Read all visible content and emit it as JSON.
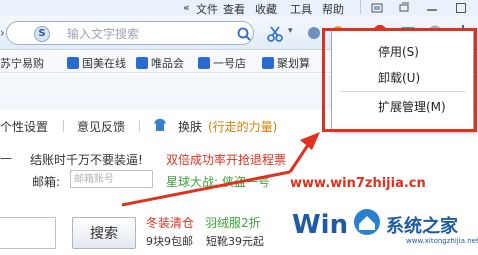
{
  "menubar": {
    "items": [
      {
        "label": "文件"
      },
      {
        "label": "查看"
      },
      {
        "label": "收藏"
      },
      {
        "label": "工具"
      },
      {
        "label": "帮助"
      }
    ]
  },
  "toolbar": {
    "search_placeholder": "输入文字搜索"
  },
  "bookmarks": {
    "items": [
      {
        "label": "苏宁易购",
        "icon": "suning-icon",
        "color": "#f2b233"
      },
      {
        "label": "国美在线",
        "icon": "gome-icon",
        "color": "#2a6bd1"
      },
      {
        "label": "唯品会",
        "icon": "vip-icon",
        "color": "#2a6bd1"
      },
      {
        "label": "一号店",
        "icon": "yhd-icon",
        "color": "#2a6bd1"
      },
      {
        "label": "聚划算",
        "icon": "juhuasuan-icon",
        "color": "#2a6bd1"
      }
    ]
  },
  "nav": {
    "personal_settings": "个性设置",
    "feedback": "意见反馈",
    "skin": "换肤",
    "skin_name": "(行走的力量)"
  },
  "promo": {
    "line1_left": "—",
    "checkout_warning": "结账时千万不要装逼!",
    "double_success": "双倍成功率开抢退程票",
    "email_label": "邮箱:",
    "email_placeholder": "邮箱账号",
    "star_battle": "星球大战: 侠盗一号",
    "site": "www.win7zhijia.cn",
    "winter_sale": "冬装清仓",
    "down_jacket": "羽绒服2折",
    "nine_yuan": "9块9包邮",
    "short_sleeve": "短靴39元起",
    "search_button": "搜索"
  },
  "watermark": {
    "brand": "系统之家",
    "url": "www.xitongzhijia.net"
  },
  "context_menu": {
    "items": [
      {
        "label": "停用(S)"
      },
      {
        "label": "卸载(U)"
      },
      {
        "label": "扩展管理(M)"
      }
    ]
  },
  "colors": {
    "accent_red": "#e0301e",
    "promo_green": "#3aa43a",
    "link_blue": "#2a6bd1"
  }
}
